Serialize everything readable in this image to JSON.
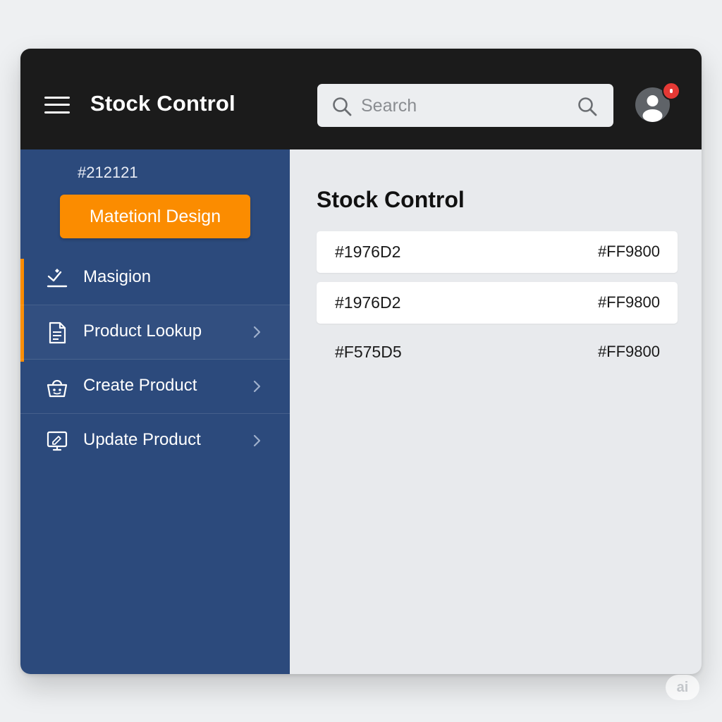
{
  "app": {
    "title": "Stock Control"
  },
  "search": {
    "placeholder": "Search",
    "value": ""
  },
  "user": {
    "avatar_icon": "person-icon",
    "notification_indicator": true
  },
  "sidebar": {
    "color_label": "#212121",
    "design_chip_label": "Matetionl Design",
    "items": [
      {
        "label": "Masigion",
        "icon": "checklist-icon",
        "has_chevron": false
      },
      {
        "label": "Product Lookup",
        "icon": "document-icon",
        "has_chevron": true,
        "active": true
      },
      {
        "label": "Create Product",
        "icon": "basket-icon",
        "has_chevron": true
      },
      {
        "label": "Update Product",
        "icon": "monitor-edit-icon",
        "has_chevron": true
      }
    ]
  },
  "main": {
    "title": "Stock Control",
    "rows": [
      {
        "left": "#1976D2",
        "right": "#FF9800"
      },
      {
        "left": "#1976D2",
        "right": "#FF9800"
      },
      {
        "left": "#F575D5",
        "right": "#FF9800"
      }
    ]
  },
  "watermark": {
    "label": "ai"
  },
  "colors": {
    "appbar": "#1b1b1b",
    "sidebar": "#2c4a7c",
    "accent": "#fb8c00",
    "notification": "#e53935",
    "content_bg": "#e8eaed"
  }
}
